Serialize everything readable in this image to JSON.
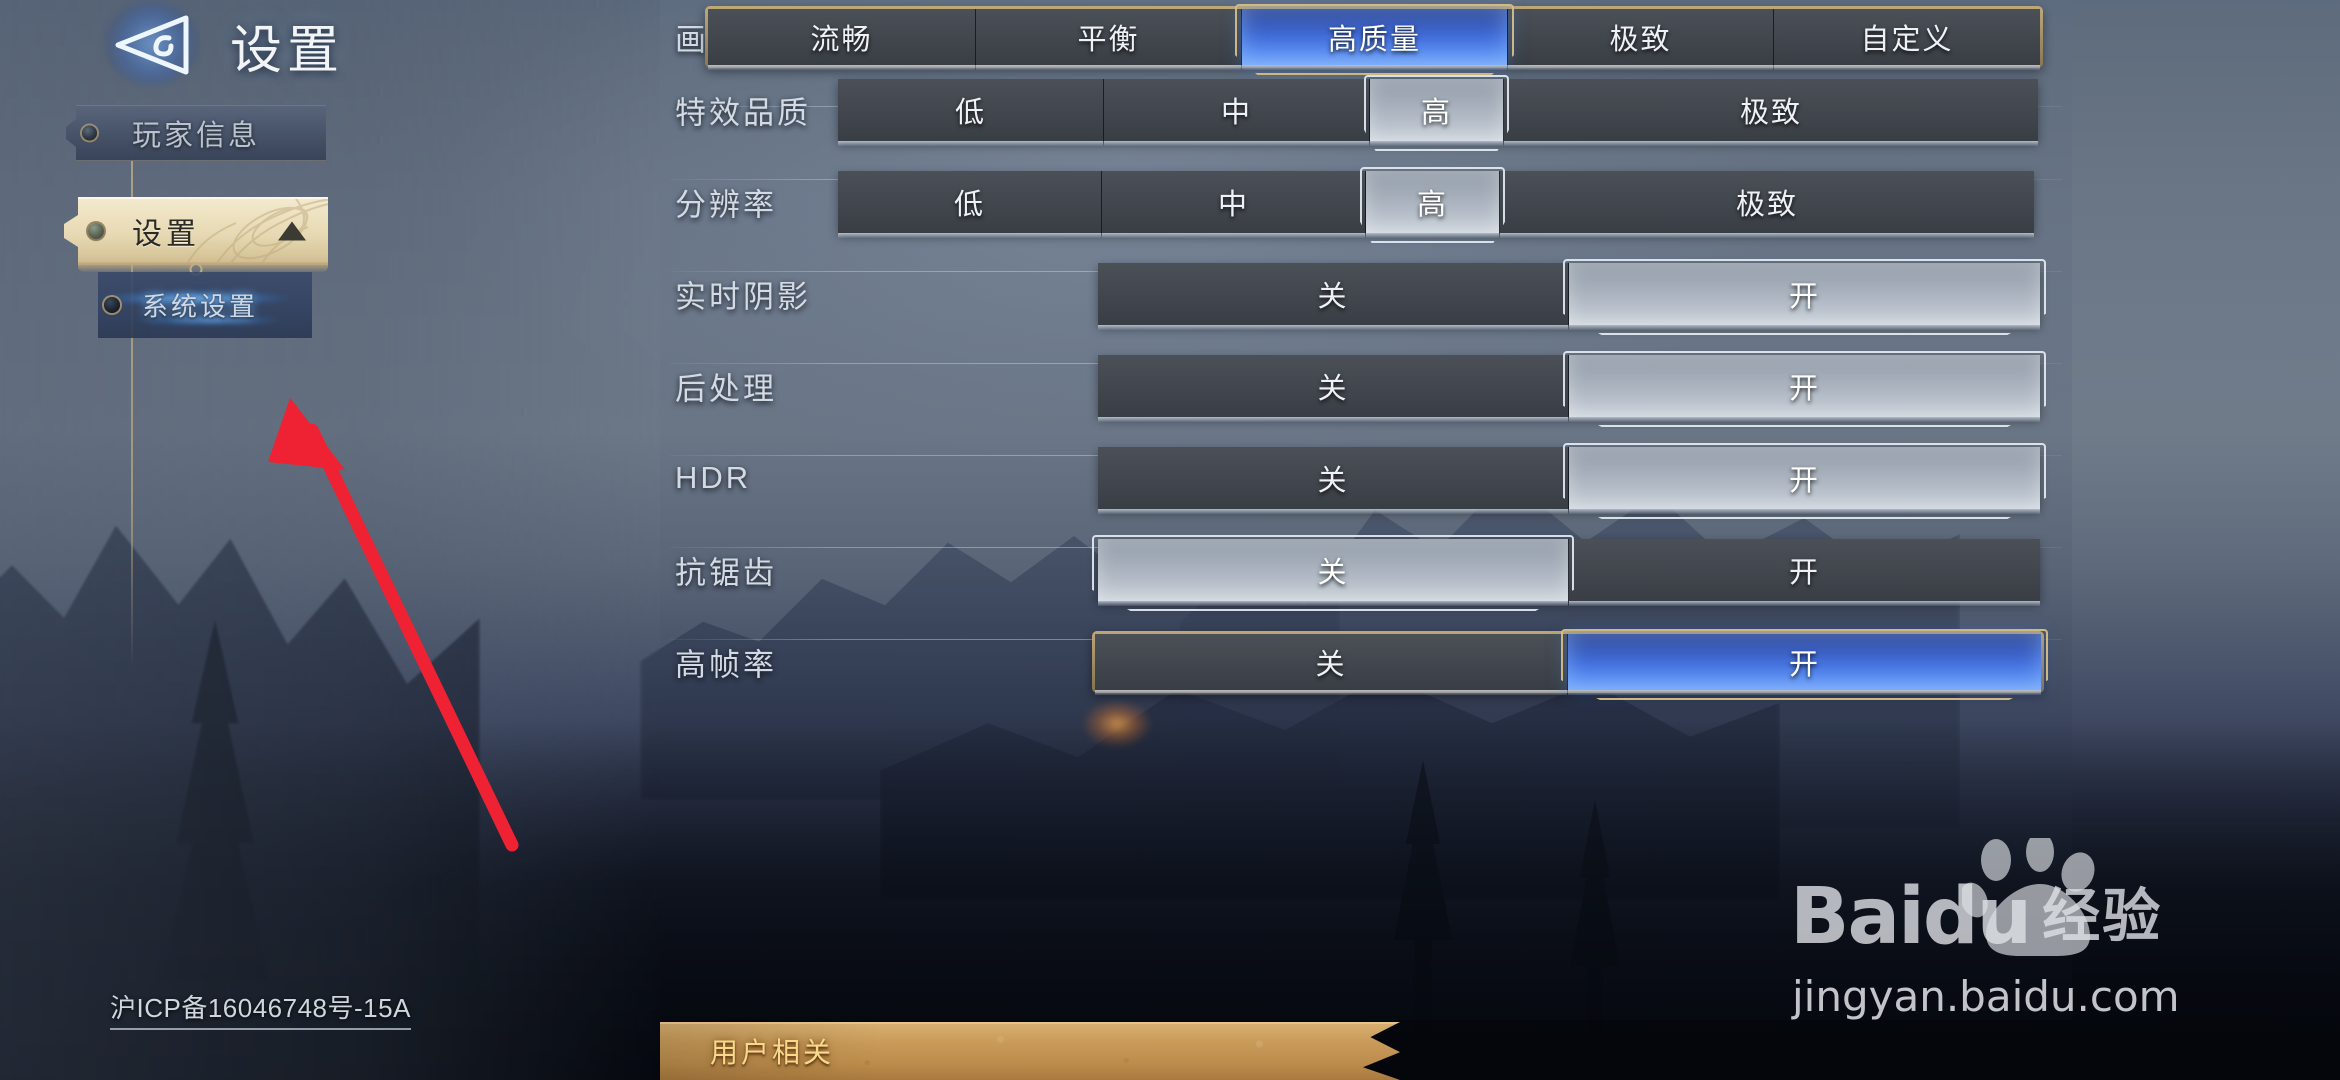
{
  "header": {
    "title": "设置",
    "logo_icon": "triangle-arrow-emblem-icon"
  },
  "sidebar": {
    "items": [
      {
        "label": "玩家信息",
        "state": "normal",
        "icon": "stud-icon"
      },
      {
        "label": "设置",
        "state": "selected",
        "icon": "stud-icon",
        "expand_icon": "triangle-up-icon"
      }
    ],
    "subitems": [
      {
        "label": "系统设置",
        "state": "active",
        "icon": "stud-icon"
      }
    ],
    "icp_notice": "沪ICP备16046748号-15A"
  },
  "settings": {
    "rows": [
      {
        "label": "画质配置",
        "type": "segmented",
        "style": "gold-frame",
        "options": [
          "流畅",
          "平衡",
          "高质量",
          "极致",
          "自定义"
        ],
        "selected": "高质量",
        "selected_index": 2,
        "highlight": "blue"
      },
      {
        "label": "特效品质",
        "type": "segmented",
        "style": "plain",
        "options": [
          "低",
          "中",
          "高",
          "极致"
        ],
        "selected": "高",
        "selected_index": 2,
        "highlight": "light"
      },
      {
        "label": "分辨率",
        "type": "segmented",
        "style": "plain",
        "options": [
          "低",
          "中",
          "高",
          "极致"
        ],
        "selected": "高",
        "selected_index": 2,
        "highlight": "light"
      },
      {
        "label": "实时阴影",
        "type": "toggle",
        "style": "plain",
        "options": [
          "关",
          "开"
        ],
        "selected": "开",
        "selected_index": 1,
        "highlight": "light"
      },
      {
        "label": "后处理",
        "type": "toggle",
        "style": "plain",
        "options": [
          "关",
          "开"
        ],
        "selected": "开",
        "selected_index": 1,
        "highlight": "light"
      },
      {
        "label": "HDR",
        "type": "toggle",
        "style": "plain",
        "options": [
          "关",
          "开"
        ],
        "selected": "开",
        "selected_index": 1,
        "highlight": "light"
      },
      {
        "label": "抗锯齿",
        "type": "toggle",
        "style": "plain",
        "options": [
          "关",
          "开"
        ],
        "selected": "关",
        "selected_index": 0,
        "highlight": "light"
      },
      {
        "label": "高帧率",
        "type": "toggle",
        "style": "gold-frame",
        "options": [
          "关",
          "开"
        ],
        "selected": "开",
        "selected_index": 1,
        "highlight": "blue"
      }
    ]
  },
  "bottom_tabs": [
    {
      "label": "用户相关",
      "state": "active"
    }
  ],
  "annotation": {
    "type": "arrow",
    "color": "#ee2233",
    "points_to": "系统设置"
  },
  "watermark": {
    "brand": "Bai",
    "brand2": "du",
    "brand_cn": "经验",
    "url": "jingyan.baidu.com",
    "paw_icon": "baidu-paw-icon"
  },
  "colors": {
    "accent_blue": "#4470dc",
    "gold": "#c4ac78",
    "panel_text": "#d3dae3",
    "annotation_red": "#ee2233"
  }
}
